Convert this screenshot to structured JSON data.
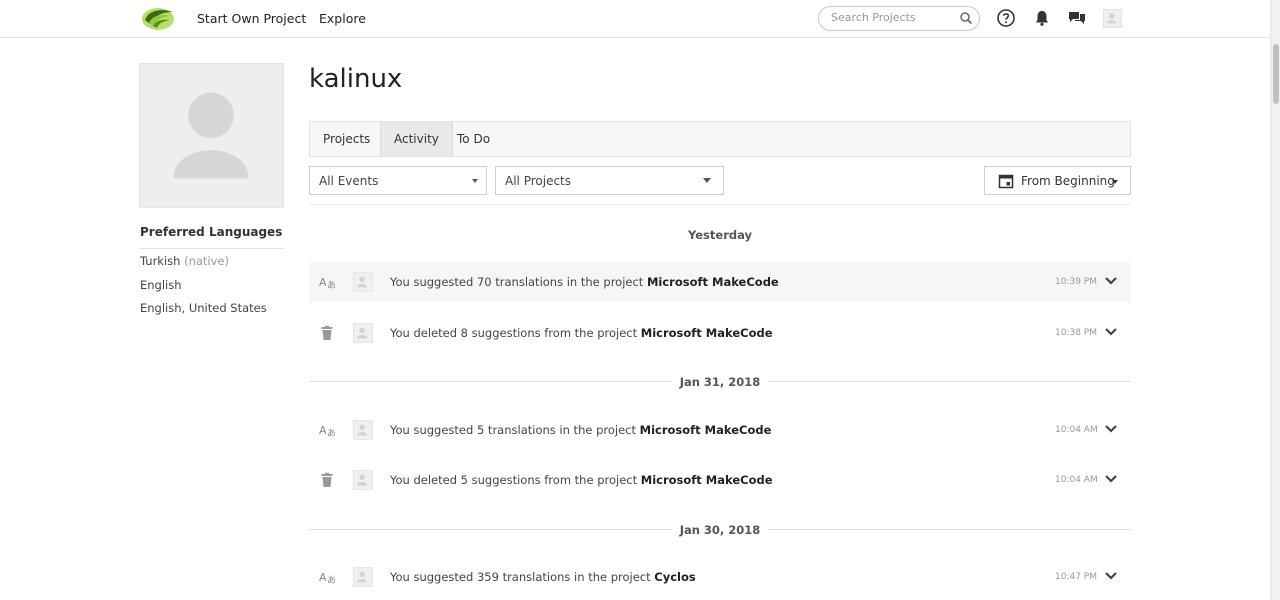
{
  "nav": {
    "start_project": "Start Own Project",
    "explore": "Explore",
    "search_placeholder": "Search Projects"
  },
  "profile": {
    "username": "kalinux",
    "preferred_languages_title": "Preferred Languages",
    "languages": [
      {
        "name": "Turkish",
        "note": "(native)"
      },
      {
        "name": "English",
        "note": ""
      },
      {
        "name": "English, United States",
        "note": ""
      }
    ]
  },
  "tabs": [
    "Projects",
    "Activity",
    "To Do"
  ],
  "active_tab": "Activity",
  "filters": {
    "events": "All Events",
    "projects": "All Projects",
    "date": "From Beginning"
  },
  "days": [
    {
      "label": "Yesterday",
      "events": [
        {
          "type": "translation",
          "text": "You suggested 70 translations in the project",
          "project": "Microsoft MakeCode",
          "time": "10:39 PM",
          "icon": "translate-icon"
        },
        {
          "type": "delete",
          "text": "You deleted 8 suggestions from the project",
          "project": "Microsoft MakeCode",
          "time": "10:38 PM",
          "icon": "trash-icon"
        }
      ]
    },
    {
      "label": "Jan 31, 2018",
      "events": [
        {
          "type": "translation",
          "text": "You suggested 5 translations in the project",
          "project": "Microsoft MakeCode",
          "time": "10:04 AM",
          "icon": "translate-icon"
        },
        {
          "type": "delete",
          "text": "You deleted 5 suggestions from the project",
          "project": "Microsoft MakeCode",
          "time": "10:04 AM",
          "icon": "trash-icon"
        }
      ]
    },
    {
      "label": "Jan 30, 2018",
      "events": [
        {
          "type": "translation",
          "text": "You suggested 359 translations in the project",
          "project": "Cyclos",
          "time": "10:47 PM",
          "icon": "translate-icon"
        }
      ]
    }
  ],
  "colors": {
    "logo_green": "#8dc63f",
    "logo_dark": "#3d6b12",
    "accent_grey": "#999999"
  }
}
